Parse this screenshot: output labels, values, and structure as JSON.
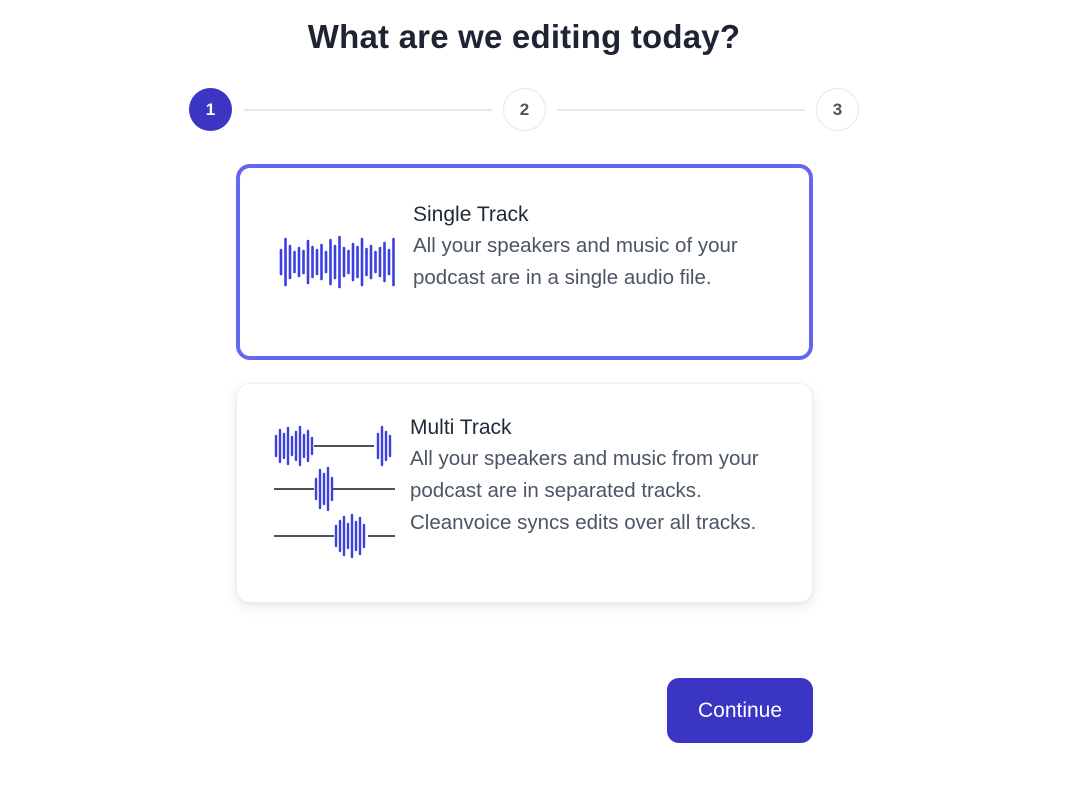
{
  "page": {
    "title": "What are we editing today?"
  },
  "stepper": {
    "steps": [
      {
        "label": "1",
        "state": "active"
      },
      {
        "label": "2",
        "state": "inactive"
      },
      {
        "label": "3",
        "state": "inactive"
      }
    ]
  },
  "options": [
    {
      "title": "Single Track",
      "description": "All your speakers and music of your podcast are in a single audio file.",
      "selected": true,
      "icon": "waveform-icon"
    },
    {
      "title": "Multi Track",
      "description": "All your speakers and music from your podcast are in separated tracks. Cleanvoice syncs edits over all tracks.",
      "selected": false,
      "icon": "multitrack-waveform-icon"
    }
  ],
  "actions": {
    "continue_label": "Continue"
  },
  "colors": {
    "accent": "#3b35c3",
    "selected_border": "#6366f1",
    "waveform": "#3b3fe0",
    "title_text": "#1e2433",
    "body_text": "#4b5563"
  }
}
